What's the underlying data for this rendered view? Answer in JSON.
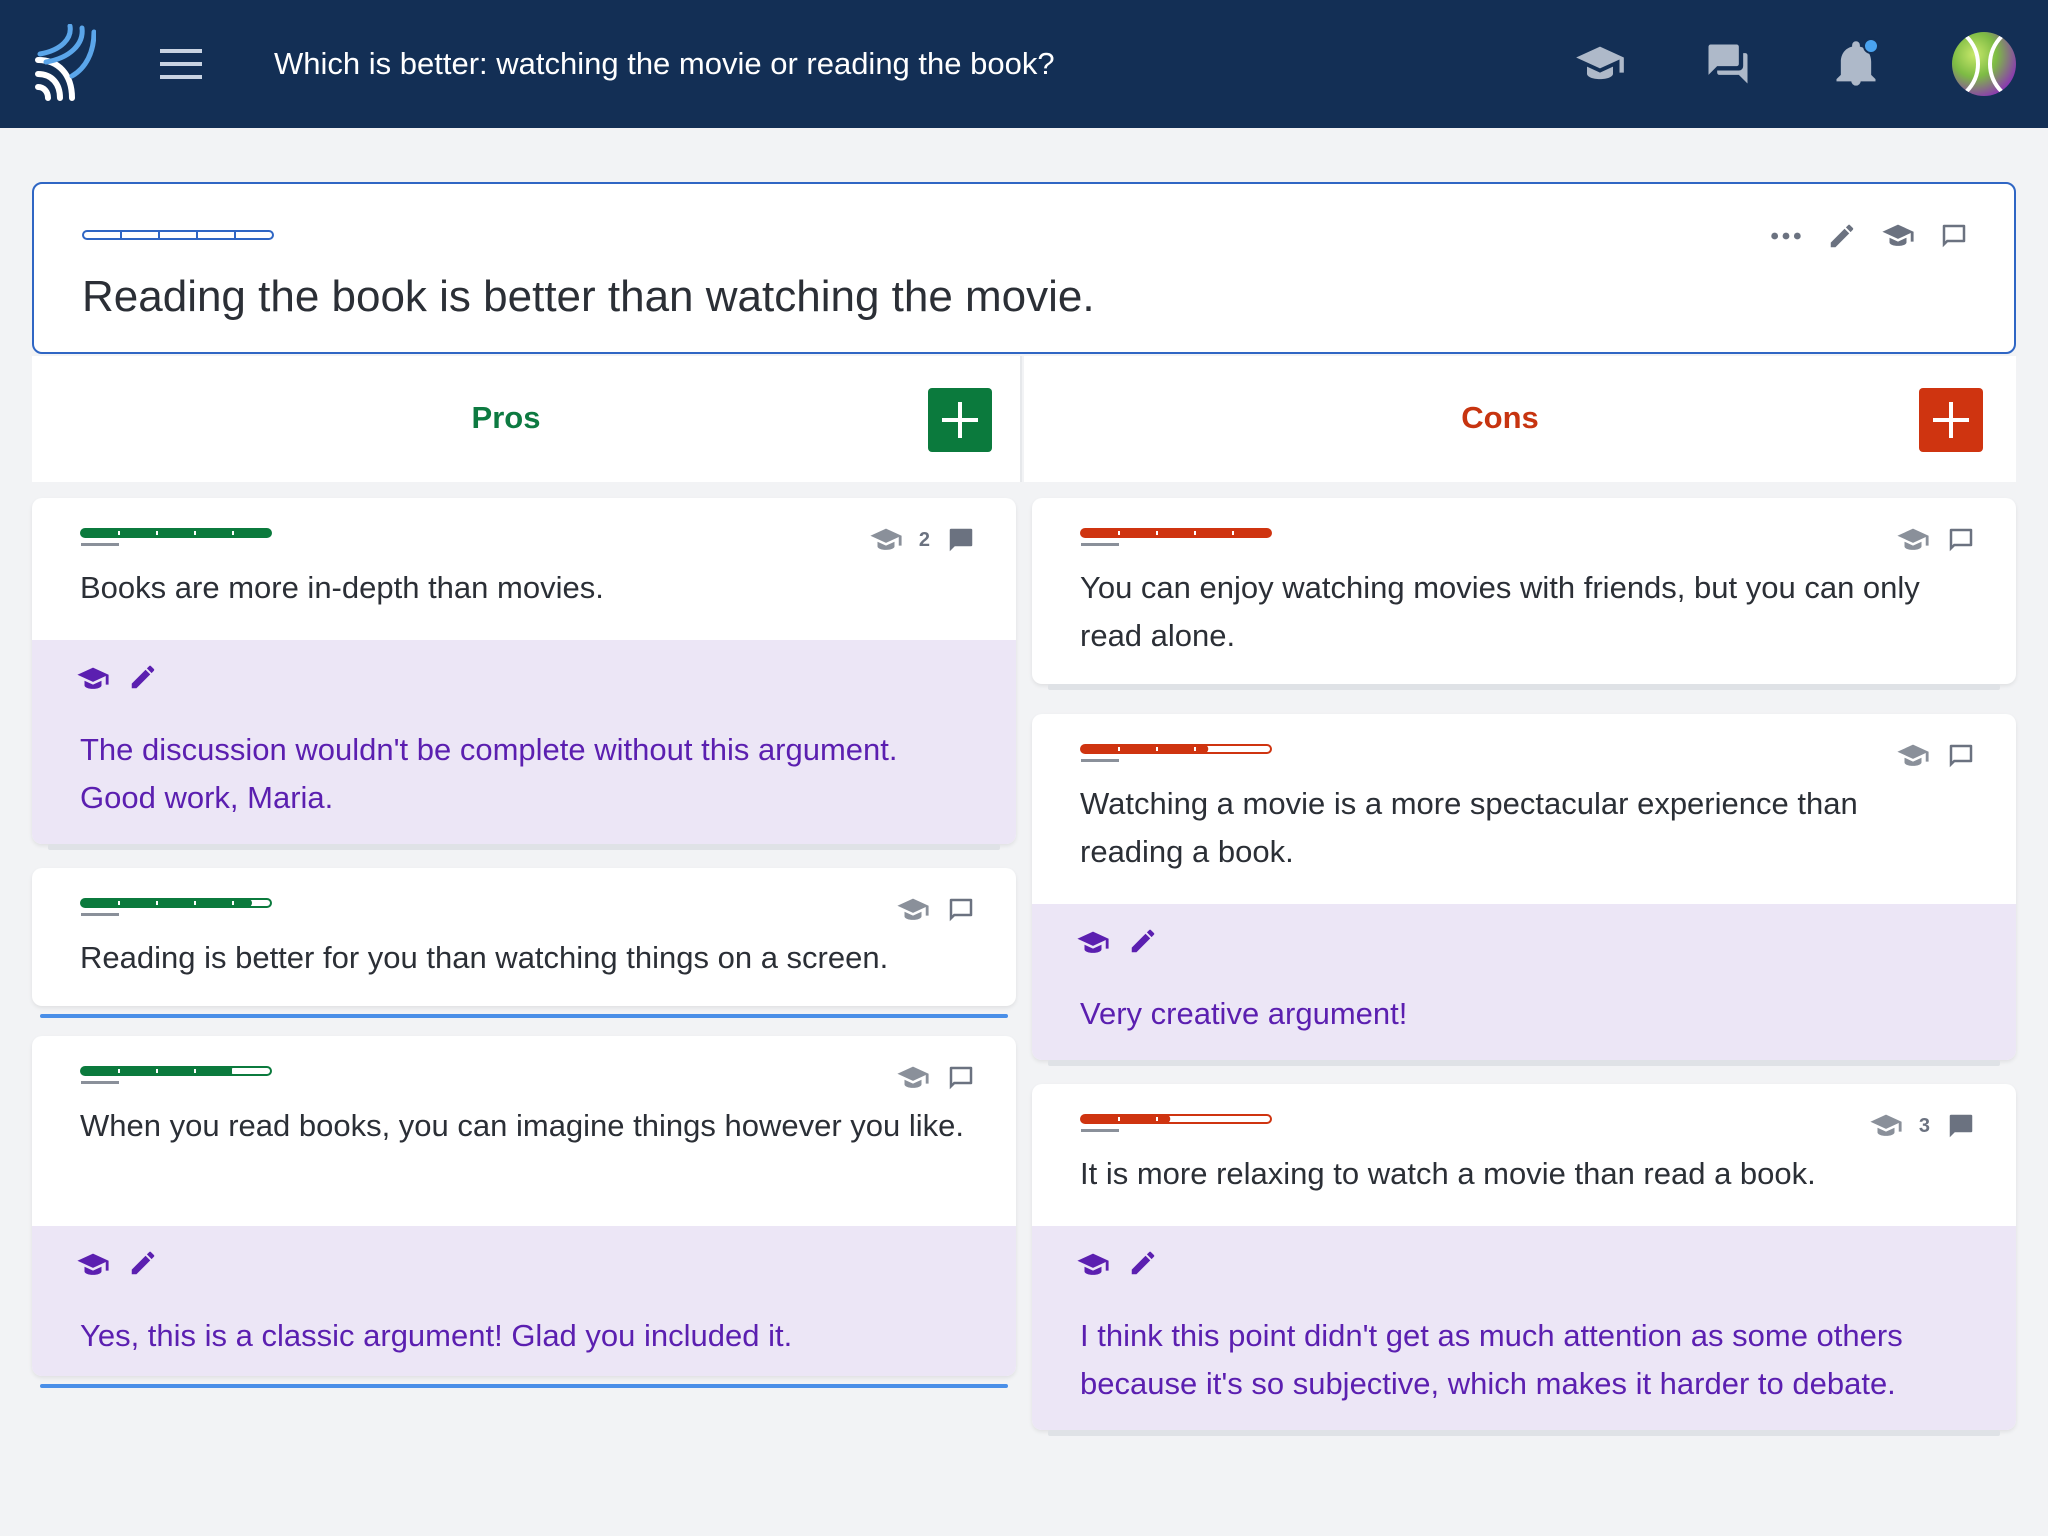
{
  "header": {
    "title": "Which is better: watching the movie or reading the book?",
    "menu_icon": "menu-icon",
    "icons": [
      "mortarboard-icon",
      "chat-bubbles-icon",
      "bell-icon",
      "avatar"
    ]
  },
  "claim": {
    "text": "Reading the book is better than watching the movie.",
    "strength": 0,
    "tools": [
      "more-icon",
      "pencil-icon",
      "mortarboard-icon",
      "comment-icon"
    ]
  },
  "columns": {
    "pros_label": "Pros",
    "cons_label": "Cons"
  },
  "pros": [
    {
      "text": "Books are more in-depth than movies.",
      "strength": 1.0,
      "comment_count": "2",
      "feedback": "The discussion wouldn't be complete without this argument. Good work, Maria."
    },
    {
      "text": "Reading is better for you than watching things on a screen.",
      "strength": 0.9,
      "comment_count": ""
    },
    {
      "text": "When you read books, you can imagine things however you like.",
      "strength": 0.8,
      "comment_count": "",
      "feedback": "Yes, this is a classic argument! Glad you included it."
    }
  ],
  "cons": [
    {
      "text": "You can enjoy watching movies with friends, but you can only read alone.",
      "strength": 1.0,
      "comment_count": ""
    },
    {
      "text": "Watching a movie is a more spectacular experience than reading a book.",
      "strength": 0.67,
      "comment_count": "",
      "feedback": "Very creative argument!"
    },
    {
      "text": "It is more relaxing to watch a movie than read a book.",
      "strength": 0.47,
      "comment_count": "3",
      "feedback": "I think this point didn't get as much attention as some others because it's so subjective, which makes it harder to debate."
    }
  ],
  "colors": {
    "header_bg": "#132f55",
    "pro": "#0b7a3d",
    "con": "#cf3410",
    "feedback_bg": "#ece6f6",
    "feedback_text": "#5b1fb0",
    "accent_blue": "#2f66c4"
  }
}
